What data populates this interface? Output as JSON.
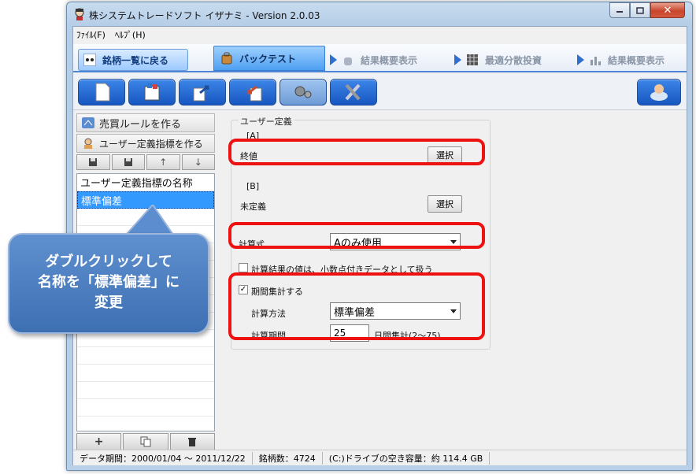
{
  "window": {
    "title": "株システムトレードソフト イザナミ - Version 2.0.03",
    "close_glyph": "✕"
  },
  "menu": {
    "file": "ﾌｧｲﾙ(F)",
    "help": "ﾍﾙﾌﾟ(H)"
  },
  "tabs": {
    "back": "銘柄一覧に戻る",
    "backtest": "バックテスト",
    "summary1": "結果概要表示",
    "dist": "最適分散投資",
    "summary2": "結果概要表示"
  },
  "left": {
    "make_rule": "売買ルールを作る",
    "make_indicator": "ユーザー定義指標を作る",
    "list_header": "ユーザー定義指標の名称",
    "list_selected": "標準偏差",
    "add": "+",
    "up_glyph": "↑",
    "down_glyph": "↓"
  },
  "form": {
    "group_title": "ユーザー定義",
    "a_label": "[A]",
    "a_value": "終値",
    "b_label": "[B]",
    "b_value": "未定義",
    "select_label": "選択",
    "formula_label": "計算式",
    "formula_value": "Aのみ使用",
    "decimal_check_label": "計算結果の値は、小数点付きデータとして扱う",
    "period_check_label": "期間集計する",
    "period_check_mark": "✓",
    "method_label": "計算方法",
    "method_value": "標準偏差",
    "period_label": "計算期間",
    "period_value": "25",
    "period_unit": "日間集計(2～75)"
  },
  "status": {
    "data_period": "データ期間：2000/01/04 ～ 2011/12/22",
    "stock_count": "銘柄数：4724",
    "disk_space": "(C:)ドライブの空き容量：約 114.4 GB"
  },
  "callout": {
    "line1": "ダブルクリックして",
    "line2": "名称を「標準偏差」に",
    "line3": "変更"
  },
  "colors": {
    "highlight": "#ee1111",
    "selected_row": "#3399ff",
    "callout": "#4a7dc0"
  }
}
